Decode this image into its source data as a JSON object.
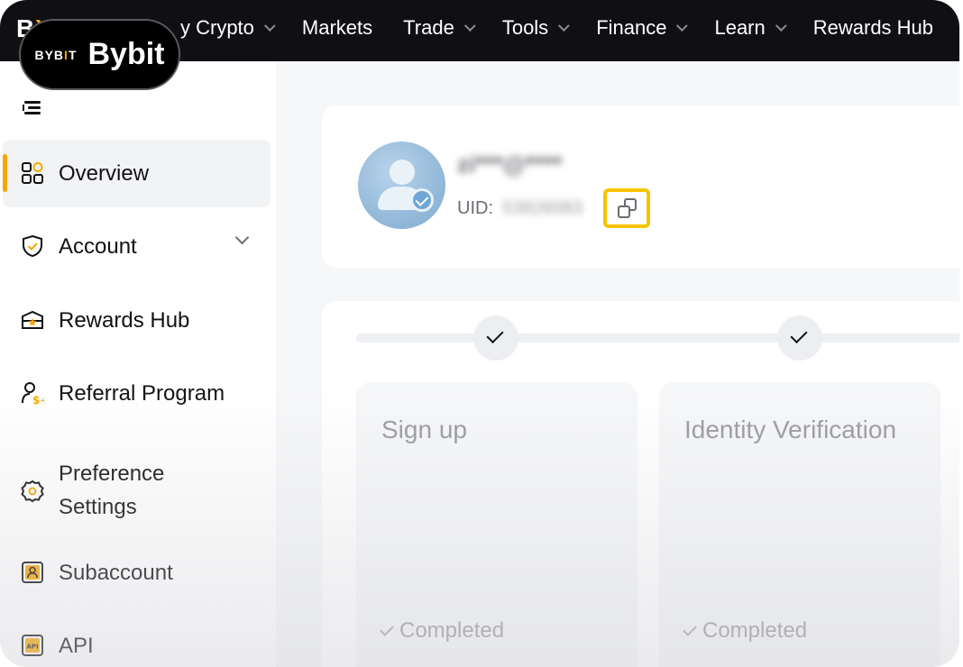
{
  "brand": {
    "mini": "BYB",
    "mini_highlight": "I",
    "mini_tail": "T",
    "name": "Bybit"
  },
  "topnav": {
    "items": [
      {
        "label": "y Crypto",
        "has_dropdown": true
      },
      {
        "label": "Markets",
        "has_dropdown": false
      },
      {
        "label": "Trade",
        "has_dropdown": true
      },
      {
        "label": "Tools",
        "has_dropdown": true
      },
      {
        "label": "Finance",
        "has_dropdown": true
      },
      {
        "label": "Learn",
        "has_dropdown": true
      },
      {
        "label": "Rewards Hub",
        "has_dropdown": false
      }
    ]
  },
  "sidebar": {
    "items": [
      {
        "label": "Overview",
        "icon": "grid-icon",
        "active": true
      },
      {
        "label": "Account",
        "icon": "shield-check-icon",
        "expandable": true
      },
      {
        "label": "Rewards Hub",
        "icon": "ticket-icon"
      },
      {
        "label": "Referral Program",
        "icon": "user-dollar-icon"
      },
      {
        "label": "Preference Settings",
        "icon": "settings-gear-icon"
      },
      {
        "label": "Subaccount",
        "icon": "subaccount-icon"
      },
      {
        "label": "API",
        "icon": "api-icon"
      }
    ]
  },
  "profile": {
    "email": "zi***@****",
    "uid_label": "UID:",
    "uid_value": "53826083"
  },
  "steps": [
    {
      "title": "Sign up",
      "status": "Completed"
    },
    {
      "title": "Identity Verification",
      "status": "Completed"
    }
  ],
  "colors": {
    "accent": "#f7a600",
    "highlight": "#f7c300",
    "nav_bg": "#101014"
  }
}
